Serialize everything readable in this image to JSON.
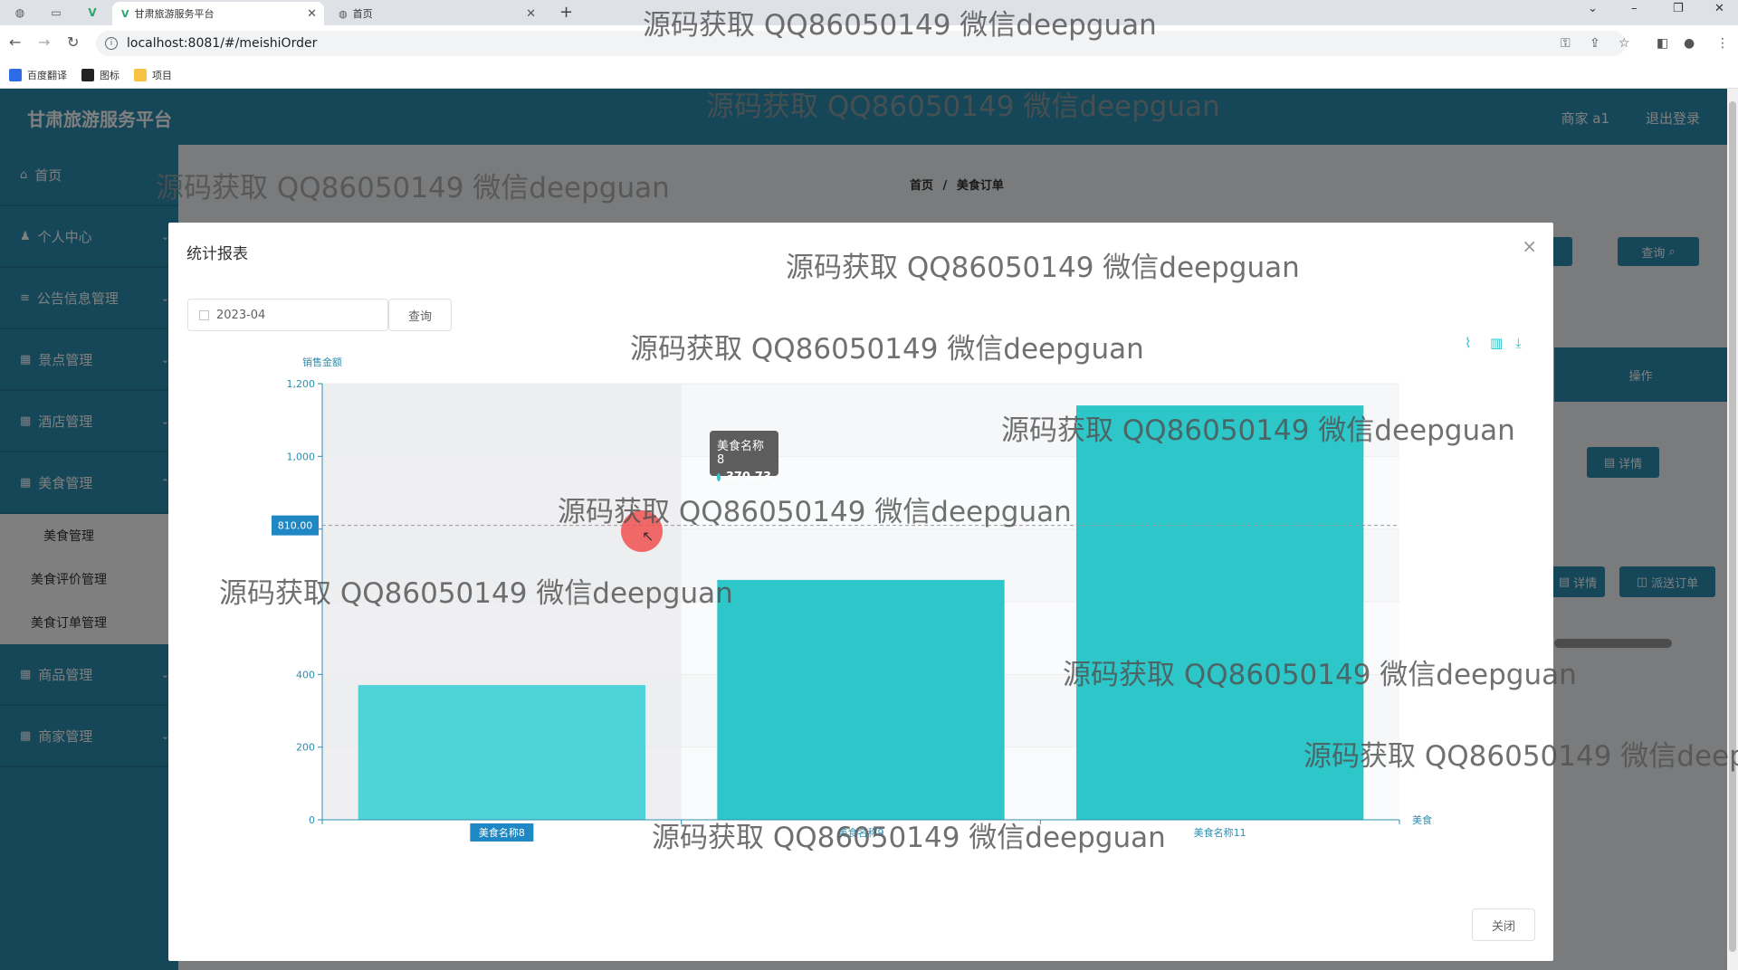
{
  "browser": {
    "tabs": [
      {
        "title": "甘肃旅游服务平台",
        "active": true
      },
      {
        "title": "首页",
        "active": false
      }
    ],
    "url": "localhost:8081/#/meishiOrder",
    "bookmarks": [
      "百度翻译",
      "图标",
      "项目"
    ]
  },
  "app": {
    "title": "甘肃旅游服务平台",
    "user": "商家 a1",
    "logout": "退出登录"
  },
  "sidebar": {
    "items": [
      {
        "label": "首页",
        "icon": "home-icon"
      },
      {
        "label": "个人中心",
        "icon": "user-icon"
      },
      {
        "label": "公告信息管理",
        "icon": "menu-icon"
      },
      {
        "label": "景点管理",
        "icon": "grid-icon"
      },
      {
        "label": "酒店管理",
        "icon": "grid-icon"
      },
      {
        "label": "美食管理",
        "icon": "grid-icon"
      }
    ],
    "subitems": [
      "美食管理",
      "美食评价管理",
      "美食订单管理"
    ],
    "items_after": [
      {
        "label": "商品管理",
        "icon": "grid-icon"
      },
      {
        "label": "商家管理",
        "icon": "grid-icon"
      }
    ]
  },
  "main": {
    "breadcrumb_home": "首页",
    "breadcrumb_sep": "/",
    "breadcrumb_current": "美食订单",
    "search_button": "查询",
    "table_header_action": "操作",
    "detail_button": "详情",
    "detail_button2": "详情",
    "dispatch_button": "派送订单"
  },
  "dialog": {
    "title": "统计报表",
    "date_value": "2023-04",
    "query_label": "查询",
    "close_label": "关闭",
    "tooltip_name": "美食名称8",
    "tooltip_value": "370.73",
    "axis_pointer_label": "810.00"
  },
  "chart_data": {
    "type": "bar",
    "categories": [
      "美食名称8",
      "美食名称9",
      "美食名称11"
    ],
    "values": [
      370.73,
      660,
      1140
    ],
    "ylabel": "销售金额",
    "xlabel": "美食",
    "ylim": [
      0,
      1200
    ],
    "yticks": [
      0,
      200,
      400,
      600,
      800,
      1000,
      1200
    ],
    "ytick_labels": [
      "0",
      "200",
      "400",
      "",
      "",
      "1,000",
      "1,200"
    ],
    "colors": [
      "#4fd3d8",
      "#2ec7c9",
      "#2ec7c9"
    ],
    "highlighted": "美食名称8",
    "grid": true
  },
  "watermark": "源码获取 QQ86050149 微信deepguan",
  "colors": {
    "primary": "#2c8fb2",
    "bar": "#2ec7c9"
  }
}
